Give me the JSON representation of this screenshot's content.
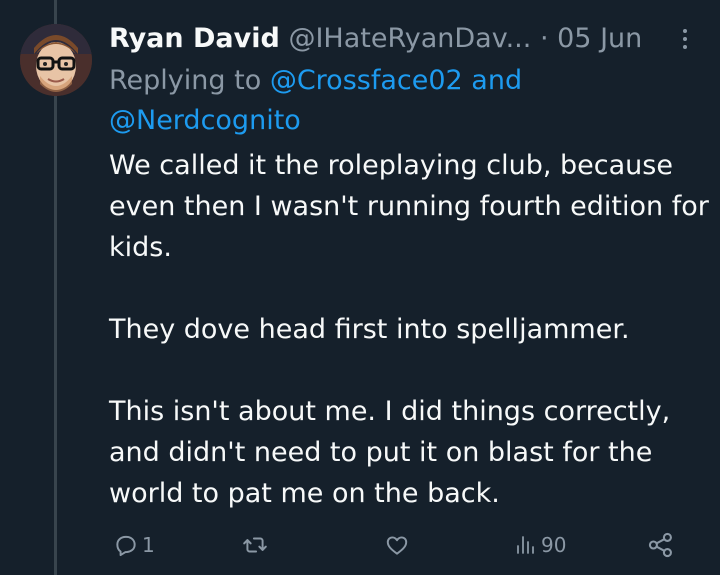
{
  "tweet": {
    "display_name": "Ryan David",
    "handle": "@IHateRyanDav...",
    "separator": "·",
    "date": "05 Jun",
    "replying_prefix": "Replying to",
    "mention_1": "@Crossface02",
    "and_word": "and",
    "mention_2": "@Nerdcognito",
    "paragraphs": [
      "We called it the roleplaying club, because even then I wasn't running fourth edition for kids.",
      "They dove head first into spelljammer.",
      "This isn't about me. I did things correctly, and didn't need to put it on blast for the world to pat me on the back."
    ]
  },
  "actions": {
    "reply_count": "1",
    "views_count": "90"
  },
  "icons": {
    "reply": "comment-icon",
    "retweet": "retweet-icon",
    "like": "heart-icon",
    "views": "views-icon",
    "share": "share-icon",
    "more": "more-icon"
  },
  "colors": {
    "background": "#15202b",
    "text": "#f7f9f9",
    "secondary": "#8b98a5",
    "link": "#1d9bf0",
    "thread_line": "#38444d"
  }
}
